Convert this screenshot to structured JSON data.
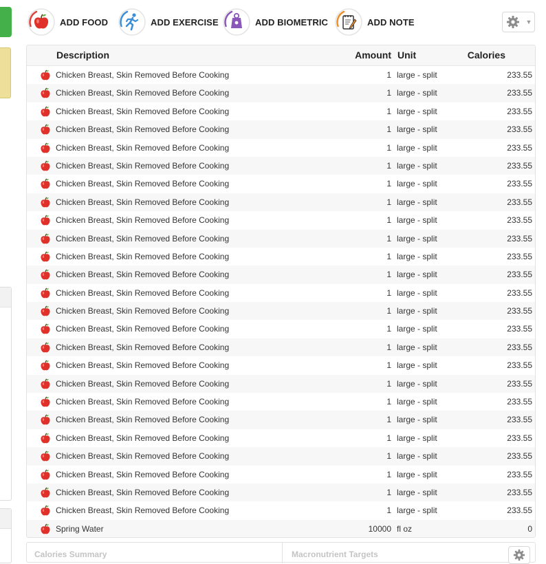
{
  "toolbar": {
    "buttons": [
      {
        "label": "ADD FOOD",
        "icon": "apple-icon",
        "ring": "#e0413c"
      },
      {
        "label": "ADD EXERCISE",
        "icon": "running-person-icon",
        "ring": "#3a8fd8"
      },
      {
        "label": "ADD BIOMETRIC",
        "icon": "scale-icon",
        "ring": "#8a58b8"
      },
      {
        "label": "ADD NOTE",
        "icon": "notepad-icon",
        "ring": "#ef8f2a"
      }
    ],
    "settings_icon": "gear-icon"
  },
  "table": {
    "headers": {
      "description": "Description",
      "amount": "Amount",
      "unit": "Unit",
      "calories": "Calories"
    },
    "rows": [
      {
        "description": "Chicken Breast, Skin Removed Before Cooking",
        "amount": "1",
        "unit": "large - split",
        "calories": "233.55"
      },
      {
        "description": "Chicken Breast, Skin Removed Before Cooking",
        "amount": "1",
        "unit": "large - split",
        "calories": "233.55"
      },
      {
        "description": "Chicken Breast, Skin Removed Before Cooking",
        "amount": "1",
        "unit": "large - split",
        "calories": "233.55"
      },
      {
        "description": "Chicken Breast, Skin Removed Before Cooking",
        "amount": "1",
        "unit": "large - split",
        "calories": "233.55"
      },
      {
        "description": "Chicken Breast, Skin Removed Before Cooking",
        "amount": "1",
        "unit": "large - split",
        "calories": "233.55"
      },
      {
        "description": "Chicken Breast, Skin Removed Before Cooking",
        "amount": "1",
        "unit": "large - split",
        "calories": "233.55"
      },
      {
        "description": "Chicken Breast, Skin Removed Before Cooking",
        "amount": "1",
        "unit": "large - split",
        "calories": "233.55"
      },
      {
        "description": "Chicken Breast, Skin Removed Before Cooking",
        "amount": "1",
        "unit": "large - split",
        "calories": "233.55"
      },
      {
        "description": "Chicken Breast, Skin Removed Before Cooking",
        "amount": "1",
        "unit": "large - split",
        "calories": "233.55"
      },
      {
        "description": "Chicken Breast, Skin Removed Before Cooking",
        "amount": "1",
        "unit": "large - split",
        "calories": "233.55"
      },
      {
        "description": "Chicken Breast, Skin Removed Before Cooking",
        "amount": "1",
        "unit": "large - split",
        "calories": "233.55"
      },
      {
        "description": "Chicken Breast, Skin Removed Before Cooking",
        "amount": "1",
        "unit": "large - split",
        "calories": "233.55"
      },
      {
        "description": "Chicken Breast, Skin Removed Before Cooking",
        "amount": "1",
        "unit": "large - split",
        "calories": "233.55"
      },
      {
        "description": "Chicken Breast, Skin Removed Before Cooking",
        "amount": "1",
        "unit": "large - split",
        "calories": "233.55"
      },
      {
        "description": "Chicken Breast, Skin Removed Before Cooking",
        "amount": "1",
        "unit": "large - split",
        "calories": "233.55"
      },
      {
        "description": "Chicken Breast, Skin Removed Before Cooking",
        "amount": "1",
        "unit": "large - split",
        "calories": "233.55"
      },
      {
        "description": "Chicken Breast, Skin Removed Before Cooking",
        "amount": "1",
        "unit": "large - split",
        "calories": "233.55"
      },
      {
        "description": "Chicken Breast, Skin Removed Before Cooking",
        "amount": "1",
        "unit": "large - split",
        "calories": "233.55"
      },
      {
        "description": "Chicken Breast, Skin Removed Before Cooking",
        "amount": "1",
        "unit": "large - split",
        "calories": "233.55"
      },
      {
        "description": "Chicken Breast, Skin Removed Before Cooking",
        "amount": "1",
        "unit": "large - split",
        "calories": "233.55"
      },
      {
        "description": "Chicken Breast, Skin Removed Before Cooking",
        "amount": "1",
        "unit": "large - split",
        "calories": "233.55"
      },
      {
        "description": "Chicken Breast, Skin Removed Before Cooking",
        "amount": "1",
        "unit": "large - split",
        "calories": "233.55"
      },
      {
        "description": "Chicken Breast, Skin Removed Before Cooking",
        "amount": "1",
        "unit": "large - split",
        "calories": "233.55"
      },
      {
        "description": "Chicken Breast, Skin Removed Before Cooking",
        "amount": "1",
        "unit": "large - split",
        "calories": "233.55"
      },
      {
        "description": "Chicken Breast, Skin Removed Before Cooking",
        "amount": "1",
        "unit": "large - split",
        "calories": "233.55"
      },
      {
        "description": "Spring Water",
        "amount": "10000",
        "unit": "fl oz",
        "calories": "0"
      }
    ]
  },
  "bottom": {
    "calories_summary_title": "Calories Summary",
    "macronutrient_targets_title": "Macronutrient Targets"
  },
  "colors": {
    "apple": "#e0302a",
    "accent_green": "#43b04a"
  }
}
